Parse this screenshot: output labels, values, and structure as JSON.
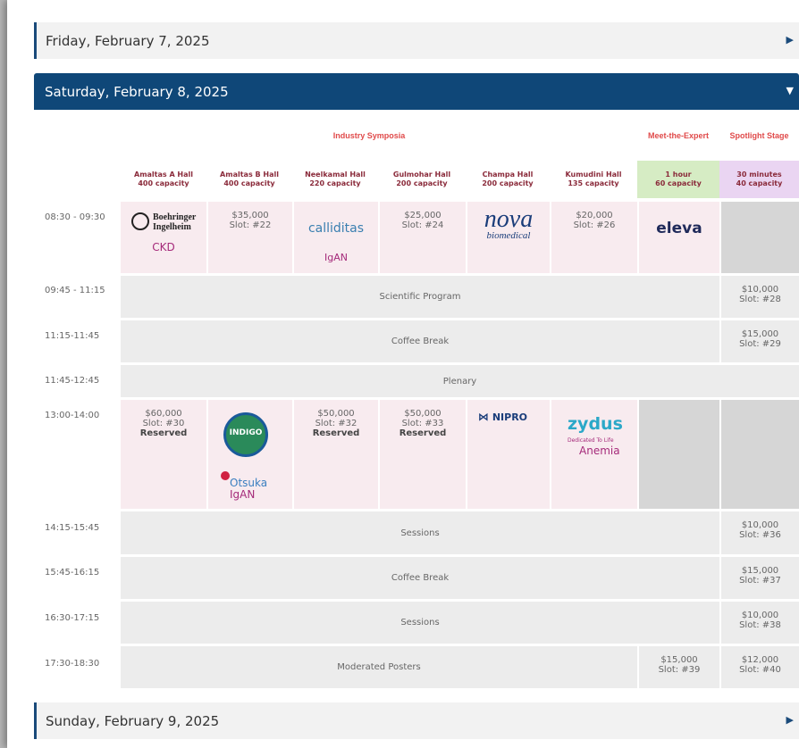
{
  "days": [
    {
      "label": "Friday, February 7, 2025"
    },
    {
      "label": "Saturday, February 8, 2025"
    },
    {
      "label": "Sunday, February 9, 2025"
    }
  ],
  "headers": {
    "industry": "Industry Symposia",
    "meet": "Meet-the-Expert",
    "spotlight": "Spotlight Stage"
  },
  "halls": [
    {
      "name": "Amaltas A Hall",
      "cap": "400 capacity"
    },
    {
      "name": "Amaltas B Hall",
      "cap": "400 capacity"
    },
    {
      "name": "Neelkamal Hall",
      "cap": "220 capacity"
    },
    {
      "name": "Gulmohar Hall",
      "cap": "200 capacity"
    },
    {
      "name": "Champa Hall",
      "cap": "200 capacity"
    },
    {
      "name": "Kumudini Hall",
      "cap": "135 capacity"
    },
    {
      "name": "1 hour",
      "cap": "60 capacity"
    },
    {
      "name": "30 minutes",
      "cap": "40 capacity"
    }
  ],
  "times": [
    "08:30 - 09:30",
    "09:45 - 11:15",
    "11:15-11:45",
    "11:45-12:45",
    "13:00-14:00",
    "14:15-15:45",
    "15:45-16:15",
    "16:30-17:15",
    "17:30-18:30"
  ],
  "row1": {
    "boehringer": "Boehringer Ingelheim",
    "ckd": "CKD",
    "p22": "$35,000",
    "s22": "Slot: #22",
    "calliditas": "calliditas",
    "igan": "IgAN",
    "p24": "$25,000",
    "s24": "Slot: #24",
    "nova": "nova",
    "novasub": "biomedical",
    "p26": "$20,000",
    "s26": "Slot: #26",
    "eleva": "eleva"
  },
  "spans": {
    "sci": "Scientific Program",
    "coffee1": "Coffee Break",
    "plenary": "Plenary",
    "sessions1": "Sessions",
    "coffee2": "Coffee Break",
    "sessions2": "Sessions",
    "posters": "Moderated Posters"
  },
  "spot": {
    "p28": "$10,000",
    "s28": "Slot: #28",
    "p29": "$15,000",
    "s29": "Slot: #29",
    "p36": "$10,000",
    "s36": "Slot: #36",
    "p37": "$15,000",
    "s37": "Slot: #37",
    "p38": "$10,000",
    "s38": "Slot: #38",
    "p39": "$15,000",
    "s39": "Slot: #39",
    "p40": "$12,000",
    "s40": "Slot: #40"
  },
  "row5": {
    "p30": "$60,000",
    "s30": "Slot: #30",
    "r30": "Reserved",
    "indigo": "INDIGO",
    "otsuka": "Otsuka",
    "igan": "IgAN",
    "p32": "$50,000",
    "s32": "Slot: #32",
    "r32": "Reserved",
    "p33": "$50,000",
    "s33": "Slot: #33",
    "r33": "Reserved",
    "nipro": "NIPRO",
    "zydus": "zydus",
    "zydustag": "Dedicated To Life",
    "anemia": "Anemia"
  },
  "colors": {
    "header": "#0f4778",
    "pink": "#f8ebef",
    "grey": "#ececec",
    "green": "#d6ecc4",
    "purple": "#ead5f2",
    "red": "#e04a4a"
  }
}
